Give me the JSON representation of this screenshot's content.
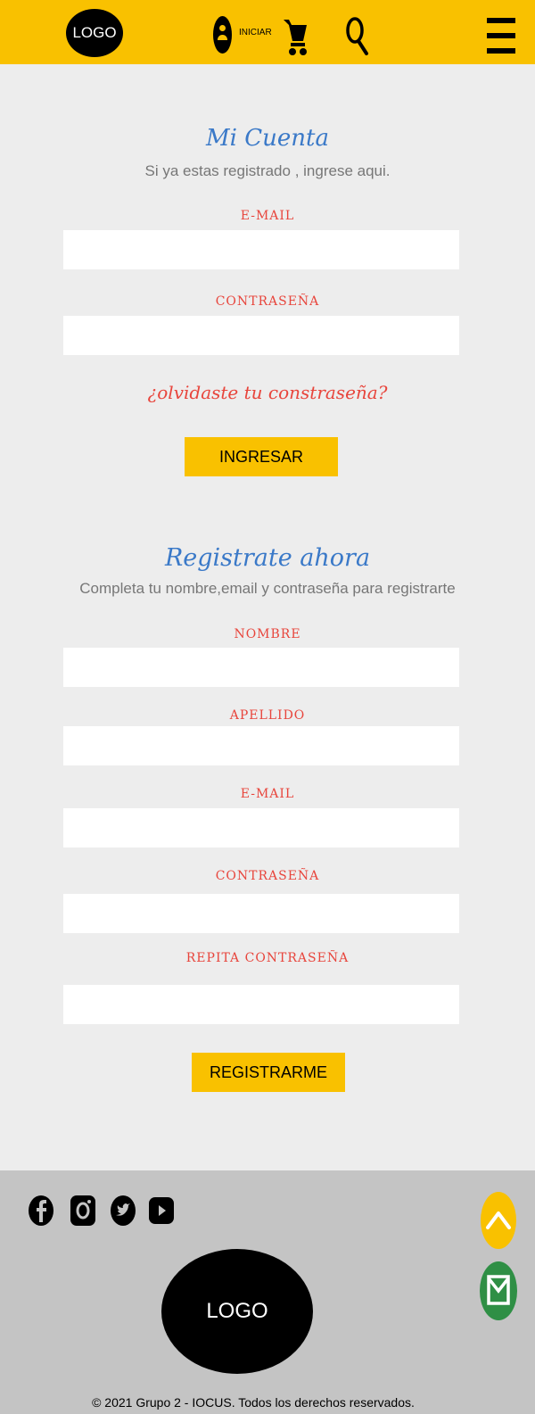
{
  "header": {
    "logo": "LOGO",
    "login_label": "INICIAR"
  },
  "login": {
    "title": "Mi Cuenta",
    "subtitle": "Si ya estas registrado , ingrese aqui.",
    "email_label": "E-MAIL",
    "password_label": "CONTRASEÑA",
    "forgot": "¿olvidaste tu constraseña?",
    "submit": "INGRESAR"
  },
  "register": {
    "title": "Registrate ahora",
    "subtitle": "Completa tu nombre,email y contraseña para registrarte",
    "name_label": "NOMBRE",
    "lastname_label": "APELLIDO",
    "email_label": "E-MAIL",
    "password_label": "CONTRASEÑA",
    "repeat_label": "REPITA CONTRASEÑA",
    "submit": "REGISTRARME"
  },
  "footer": {
    "logo": "LOGO",
    "copyright": "© 2021 Grupo 2 - IOCUS. Todos los derechos reservados.",
    "social_icons": [
      "facebook-icon",
      "instagram-icon",
      "twitter-icon",
      "youtube-icon"
    ]
  },
  "colors": {
    "accent": "#f9c100",
    "title_blue": "#3a79c8",
    "label_red": "#e8453c",
    "footer_bg": "#c4c4c4",
    "mail_green": "#2f8f45"
  }
}
